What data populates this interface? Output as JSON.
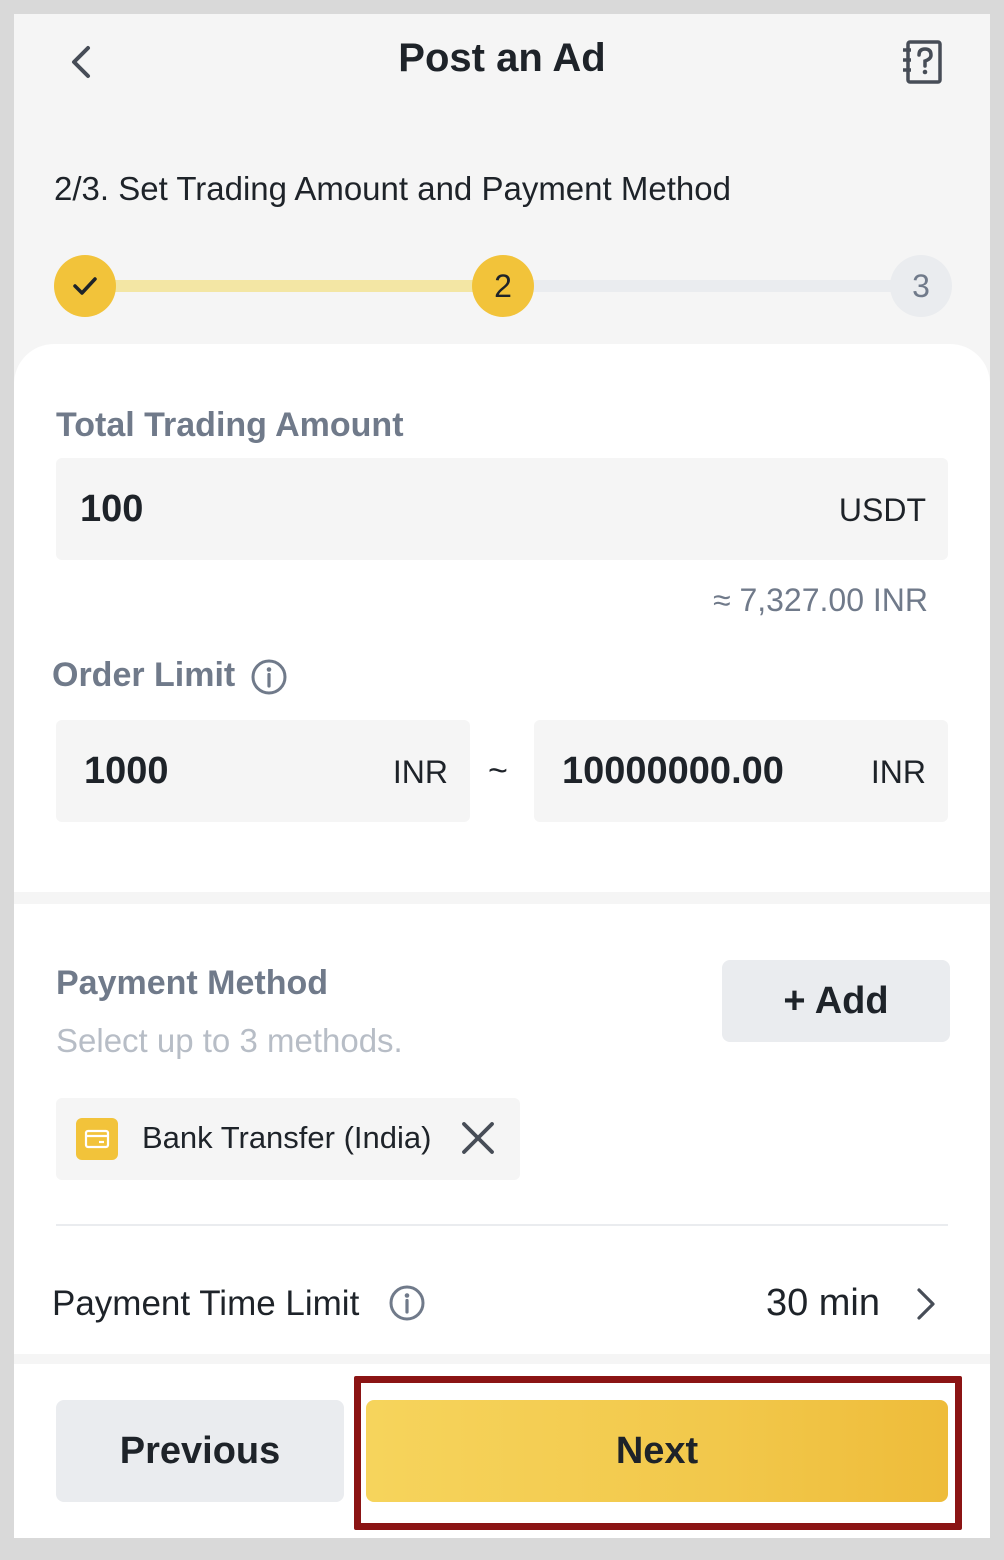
{
  "header": {
    "title": "Post an Ad",
    "back_icon": "chevron-left-icon",
    "help_icon": "help-document-icon"
  },
  "step": {
    "title": "2/3. Set Trading Amount and Payment Method",
    "steps": [
      {
        "label": "✓",
        "status": "done"
      },
      {
        "label": "2",
        "status": "current"
      },
      {
        "label": "3",
        "status": "upcoming"
      }
    ]
  },
  "total_trading_amount": {
    "label": "Total Trading Amount",
    "value": "100",
    "unit": "USDT",
    "approx": "≈ 7,327.00 INR"
  },
  "order_limit": {
    "label": "Order Limit",
    "min_value": "1000",
    "min_unit": "INR",
    "separator": "~",
    "max_value": "10000000.00",
    "max_unit": "INR"
  },
  "payment_method": {
    "label": "Payment Method",
    "hint": "Select up to 3 methods.",
    "add_label": "+ Add",
    "selected": [
      {
        "label": "Bank Transfer (India)",
        "icon": "bank-card-icon"
      }
    ]
  },
  "payment_time_limit": {
    "label": "Payment Time Limit",
    "value": "30 min"
  },
  "actions": {
    "previous_label": "Previous",
    "next_label": "Next"
  },
  "colors": {
    "accent": "#f2c33a",
    "highlight": "#8b1414",
    "muted": "#707a8a"
  }
}
